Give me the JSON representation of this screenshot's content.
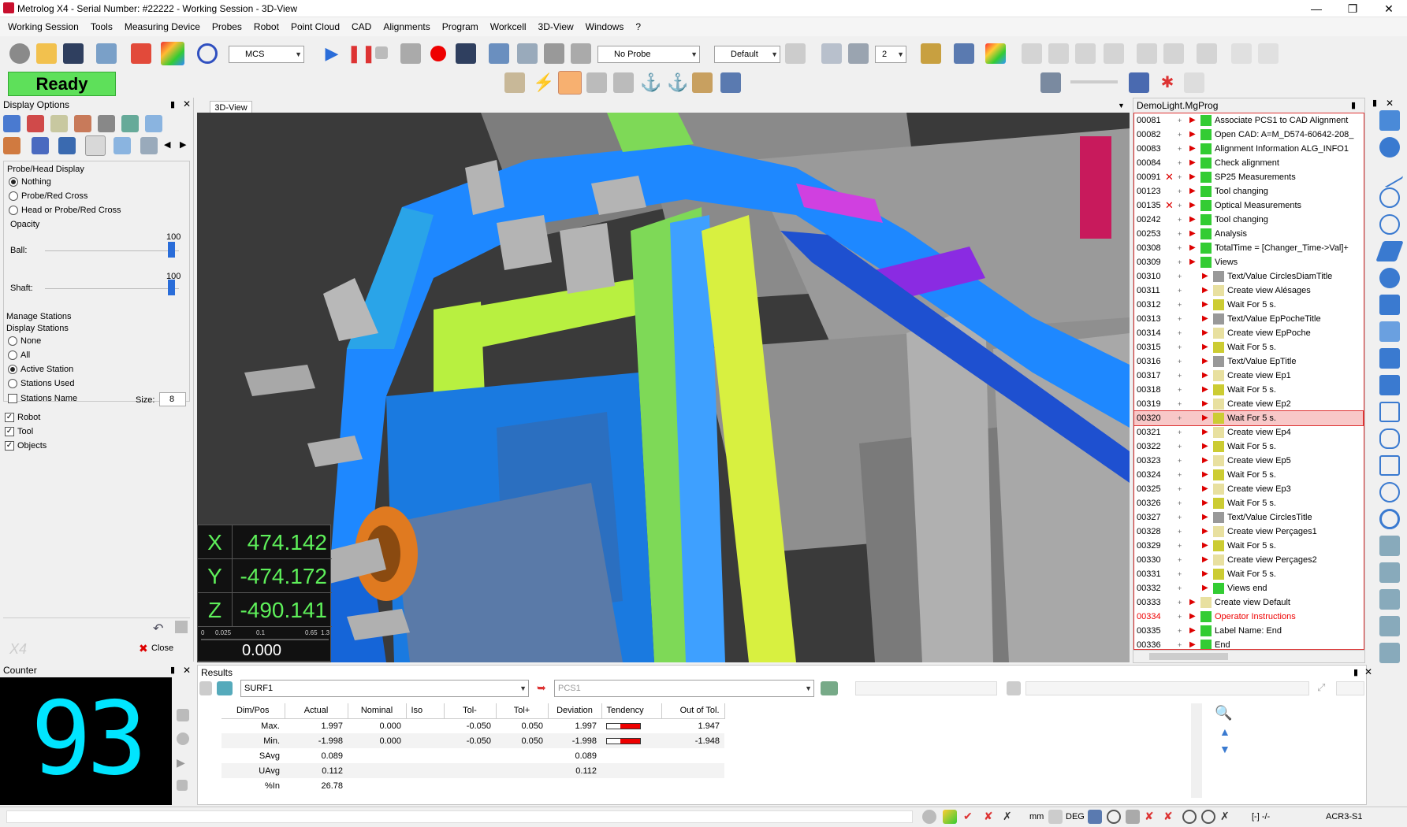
{
  "window": {
    "title": "Metrolog X4 - Serial Number: #22222 - Working Session - 3D-View"
  },
  "menu": [
    "Working Session",
    "Tools",
    "Measuring Device",
    "Probes",
    "Robot",
    "Point Cloud",
    "CAD",
    "Alignments",
    "Program",
    "Workcell",
    "3D-View",
    "Windows",
    "?"
  ],
  "toolbar": {
    "mcs_value": "MCS",
    "probe_value": "No Probe",
    "default_value": "Default",
    "count_value": "2"
  },
  "status": {
    "ready": "Ready"
  },
  "display_options": {
    "title": "Display Options",
    "probe_head": {
      "title": "Probe/Head Display",
      "options": [
        "Nothing",
        "Probe/Red Cross",
        "Head or Probe/Red Cross"
      ],
      "selected": 0
    },
    "opacity": {
      "title": "Opacity",
      "ball_label": "Ball:",
      "ball_value": "100",
      "shaft_label": "Shaft:",
      "shaft_value": "100"
    },
    "stations": {
      "title": "Manage Stations",
      "subtitle": "Display Stations",
      "options": [
        "None",
        "All",
        "Active Station",
        "Stations Used"
      ],
      "selected": 2,
      "name_label": "Stations Name",
      "size_label": "Size:",
      "size_value": "8"
    },
    "checks": [
      {
        "label": "Robot"
      },
      {
        "label": "Tool"
      },
      {
        "label": "Objects"
      }
    ],
    "close_label": "Close"
  },
  "view": {
    "tab": "3D-View",
    "coords": {
      "x_label": "X",
      "x": "474.142",
      "y_label": "Y",
      "y": "-474.172",
      "z_label": "Z",
      "z": "-490.141"
    },
    "scale_ticks": [
      "0",
      "0.025",
      "0.1",
      "0.65",
      "1.3"
    ],
    "scale_value": "0.000"
  },
  "program": {
    "title": "DemoLight.MgProg",
    "rows": [
      {
        "num": "00081",
        "label": "Associate PCS1 to CAD Alignment",
        "indent": 1
      },
      {
        "num": "00082",
        "label": "Open CAD: A=M_D574-60642-208_",
        "indent": 1
      },
      {
        "num": "00083",
        "label": "Alignment Information ALG_INFO1",
        "indent": 1
      },
      {
        "num": "00084",
        "label": "Check alignment",
        "indent": 1
      },
      {
        "num": "00091",
        "label": "SP25 Measurements",
        "indent": 1,
        "x": true
      },
      {
        "num": "00123",
        "label": "Tool changing",
        "indent": 1
      },
      {
        "num": "00135",
        "label": "Optical Measurements",
        "indent": 1,
        "x": true
      },
      {
        "num": "00242",
        "label": "Tool changing",
        "indent": 1
      },
      {
        "num": "00253",
        "label": "Analysis",
        "indent": 1
      },
      {
        "num": "00308",
        "label": "TotalTime = [Changer_Time->Val]+",
        "indent": 1
      },
      {
        "num": "00309",
        "label": "Views",
        "indent": 1
      },
      {
        "num": "00310",
        "label": "Text/Value CirclesDiamTitle",
        "indent": 2
      },
      {
        "num": "00311",
        "label": "Create view Alésages",
        "indent": 2
      },
      {
        "num": "00312",
        "label": "Wait For 5 s.",
        "indent": 2
      },
      {
        "num": "00313",
        "label": "Text/Value EpPocheTitle",
        "indent": 2
      },
      {
        "num": "00314",
        "label": "Create view EpPoche",
        "indent": 2
      },
      {
        "num": "00315",
        "label": "Wait For 5 s.",
        "indent": 2
      },
      {
        "num": "00316",
        "label": "Text/Value EpTitle",
        "indent": 2
      },
      {
        "num": "00317",
        "label": "Create view Ep1",
        "indent": 2
      },
      {
        "num": "00318",
        "label": "Wait For 5 s.",
        "indent": 2
      },
      {
        "num": "00319",
        "label": "Create view Ep2",
        "indent": 2
      },
      {
        "num": "00320",
        "label": "Wait For 5 s.",
        "indent": 2,
        "current": true
      },
      {
        "num": "00321",
        "label": "Create view Ep4",
        "indent": 2
      },
      {
        "num": "00322",
        "label": "Wait For 5 s.",
        "indent": 2
      },
      {
        "num": "00323",
        "label": "Create view Ep5",
        "indent": 2
      },
      {
        "num": "00324",
        "label": "Wait For 5 s.",
        "indent": 2
      },
      {
        "num": "00325",
        "label": "Create view Ep3",
        "indent": 2
      },
      {
        "num": "00326",
        "label": "Wait For 5 s.",
        "indent": 2
      },
      {
        "num": "00327",
        "label": "Text/Value CirclesTitle",
        "indent": 2
      },
      {
        "num": "00328",
        "label": "Create view Perçages1",
        "indent": 2
      },
      {
        "num": "00329",
        "label": "Wait For 5 s.",
        "indent": 2
      },
      {
        "num": "00330",
        "label": "Create view Perçages2",
        "indent": 2
      },
      {
        "num": "00331",
        "label": "Wait For 5 s.",
        "indent": 2
      },
      {
        "num": "00332",
        "label": "Views end",
        "indent": 2
      },
      {
        "num": "00333",
        "label": "Create view Default",
        "indent": 1
      },
      {
        "num": "00334",
        "label": "Operator Instructions",
        "indent": 1,
        "red": true
      },
      {
        "num": "00335",
        "label": "Label Name: End",
        "indent": 1
      },
      {
        "num": "00336",
        "label": "End",
        "indent": 1
      }
    ]
  },
  "counter": {
    "title": "Counter",
    "value": "93"
  },
  "results": {
    "title": "Results",
    "feature": "SURF1",
    "pcs": "PCS1",
    "headers": [
      "Dim/Pos",
      "Actual",
      "Nominal",
      "Iso",
      "Tol-",
      "Tol+",
      "Deviation",
      "Tendency",
      "Out of Tol."
    ],
    "rows": [
      {
        "dim": "Max.",
        "actual": "1.997",
        "nominal": "0.000",
        "iso": "",
        "tolm": "-0.050",
        "tolp": "0.050",
        "dev": "1.997",
        "tend": true,
        "out": "1.947"
      },
      {
        "dim": "Min.",
        "actual": "-1.998",
        "nominal": "0.000",
        "iso": "",
        "tolm": "-0.050",
        "tolp": "0.050",
        "dev": "-1.998",
        "tend": true,
        "out": "-1.948"
      },
      {
        "dim": "SAvg",
        "actual": "0.089",
        "nominal": "",
        "iso": "",
        "tolm": "",
        "tolp": "",
        "dev": "0.089",
        "tend": false,
        "out": ""
      },
      {
        "dim": "UAvg",
        "actual": "0.112",
        "nominal": "",
        "iso": "",
        "tolm": "",
        "tolp": "",
        "dev": "0.112",
        "tend": false,
        "out": ""
      },
      {
        "dim": "%In",
        "actual": "26.78",
        "nominal": "",
        "iso": "",
        "tolm": "",
        "tolp": "",
        "dev": "",
        "tend": false,
        "out": ""
      }
    ]
  },
  "statusbar": {
    "unit": "mm",
    "angle": "DEG",
    "coord": "[-] -/-",
    "station": "ACR3-S1"
  }
}
